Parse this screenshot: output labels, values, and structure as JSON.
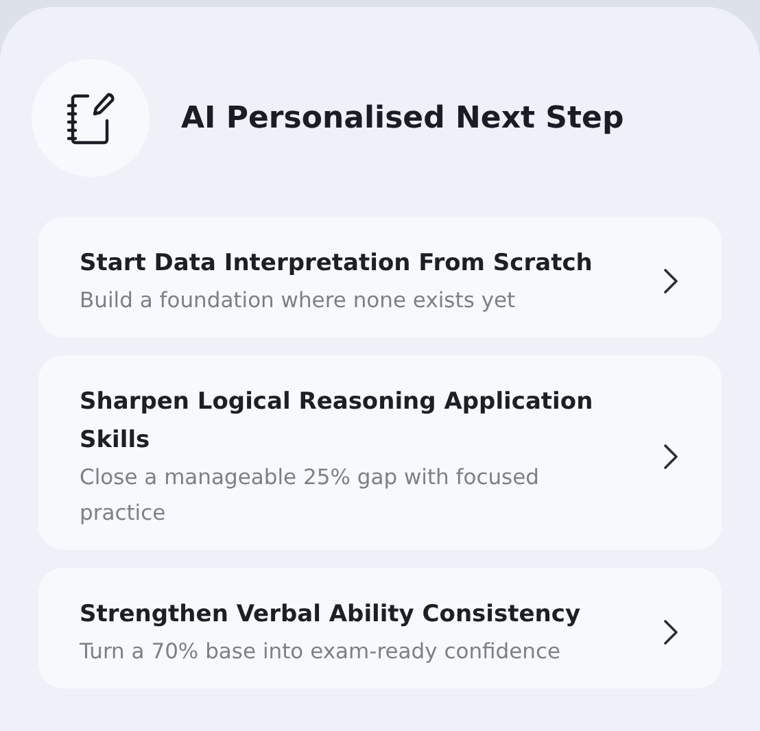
{
  "header": {
    "title": "AI Personalised Next Step"
  },
  "steps": [
    {
      "title": "Start Data Interpretation From Scratch",
      "subtitle": "Build a foundation where none exists yet"
    },
    {
      "title": "Sharpen Logical Reasoning Application Skills",
      "subtitle": "Close a manageable 25% gap with focused practice"
    },
    {
      "title": "Strengthen Verbal Ability Consistency",
      "subtitle": "Turn a 70% base into exam-ready confidence"
    }
  ]
}
